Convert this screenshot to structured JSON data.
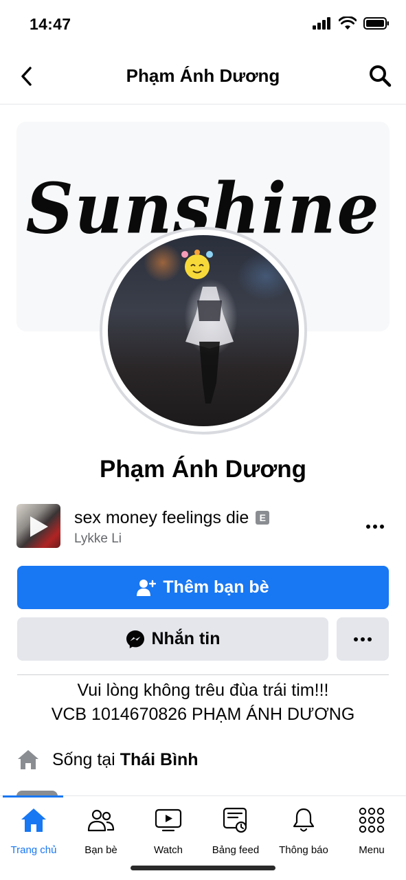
{
  "status_bar": {
    "time": "14:47"
  },
  "header": {
    "title": "Phạm Ánh Dương"
  },
  "cover": {
    "text": "Sunshine"
  },
  "profile": {
    "name": "Phạm Ánh Dương"
  },
  "music": {
    "title": "sex money feelings die",
    "explicit_badge": "E",
    "artist": "Lykke Li"
  },
  "actions": {
    "add_friend_label": "Thêm bạn bè",
    "message_label": "Nhắn tin"
  },
  "bio": {
    "line1": "Vui lòng không trêu đùa trái tim!!!",
    "line2": "VCB 1014670826 PHẠM ÁNH DƯƠNG"
  },
  "details": {
    "lives_in_prefix": "Sống tại",
    "lives_in_place": "Thái Bình"
  },
  "tabs": [
    {
      "label": "Trang chủ",
      "icon": "home-icon",
      "active": true
    },
    {
      "label": "Bạn bè",
      "icon": "friends-icon"
    },
    {
      "label": "Watch",
      "icon": "watch-icon"
    },
    {
      "label": "Bảng feed",
      "icon": "feed-icon"
    },
    {
      "label": "Thông báo",
      "icon": "bell-icon"
    },
    {
      "label": "Menu",
      "icon": "menu-grid-icon"
    }
  ],
  "colors": {
    "accent": "#1877f2",
    "secondary_button": "#e4e6eb",
    "muted_text": "#65676b"
  }
}
